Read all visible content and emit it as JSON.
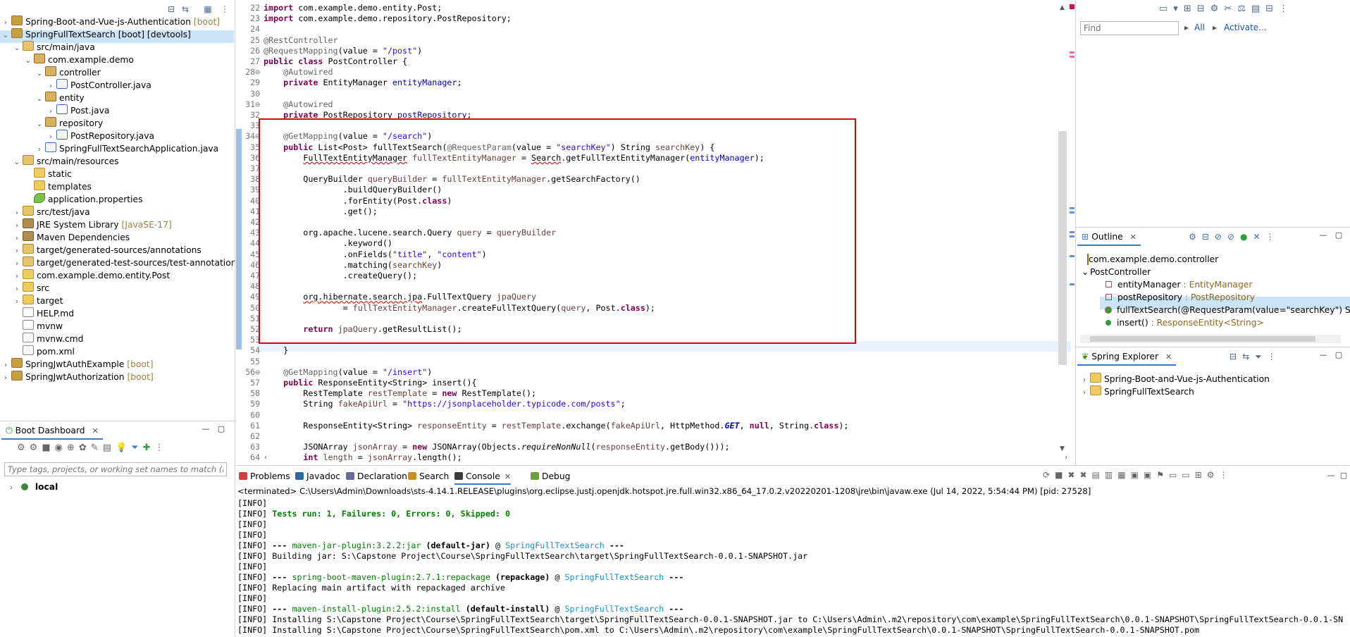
{
  "explorer": {
    "items": [
      {
        "arrow": "›",
        "icon": "proj",
        "label": "Spring-Boot-and-Vue-js-Authentication",
        "tag": "[boot]",
        "indent": 0
      },
      {
        "arrow": "⌄",
        "icon": "proj",
        "label": "SpringFullTextSearch [boot] [devtools]",
        "tag": "",
        "indent": 0
      },
      {
        "arrow": "⌄",
        "icon": "src",
        "label": "src/main/java",
        "tag": "",
        "indent": 1
      },
      {
        "arrow": "⌄",
        "icon": "pkg",
        "label": "com.example.demo",
        "tag": "",
        "indent": 2
      },
      {
        "arrow": "⌄",
        "icon": "pkg",
        "label": "controller",
        "tag": "",
        "indent": 3
      },
      {
        "arrow": "›",
        "icon": "java",
        "label": "PostController.java",
        "tag": "",
        "indent": 4
      },
      {
        "arrow": "⌄",
        "icon": "pkg",
        "label": "entity",
        "tag": "",
        "indent": 3
      },
      {
        "arrow": "›",
        "icon": "java",
        "label": "Post.java",
        "tag": "",
        "indent": 4
      },
      {
        "arrow": "⌄",
        "icon": "pkg",
        "label": "repository",
        "tag": "",
        "indent": 3
      },
      {
        "arrow": "›",
        "icon": "java",
        "label": "PostRepository.java",
        "tag": "",
        "indent": 4
      },
      {
        "arrow": "›",
        "icon": "java",
        "label": "SpringFullTextSearchApplication.java",
        "tag": "",
        "indent": 3
      },
      {
        "arrow": "⌄",
        "icon": "src",
        "label": "src/main/resources",
        "tag": "",
        "indent": 1
      },
      {
        "arrow": "",
        "icon": "folder",
        "label": "static",
        "tag": "",
        "indent": 2
      },
      {
        "arrow": "",
        "icon": "folder",
        "label": "templates",
        "tag": "",
        "indent": 2
      },
      {
        "arrow": "",
        "icon": "leaf",
        "label": "application.properties",
        "tag": "",
        "indent": 2
      },
      {
        "arrow": "›",
        "icon": "src",
        "label": "src/test/java",
        "tag": "",
        "indent": 1
      },
      {
        "arrow": "›",
        "icon": "lib",
        "label": "JRE System Library",
        "tag": "[JavaSE-17]",
        "indent": 1
      },
      {
        "arrow": "›",
        "icon": "lib",
        "label": "Maven Dependencies",
        "tag": "",
        "indent": 1
      },
      {
        "arrow": "›",
        "icon": "src",
        "label": "target/generated-sources/annotations",
        "tag": "",
        "indent": 1
      },
      {
        "arrow": "›",
        "icon": "src",
        "label": "target/generated-test-sources/test-annotations",
        "tag": "",
        "indent": 1
      },
      {
        "arrow": "›",
        "icon": "folder",
        "label": "com.example.demo.entity.Post",
        "tag": "",
        "indent": 1
      },
      {
        "arrow": "›",
        "icon": "folder",
        "label": "src",
        "tag": "",
        "indent": 1
      },
      {
        "arrow": "›",
        "icon": "folder",
        "label": "target",
        "tag": "",
        "indent": 1
      },
      {
        "arrow": "",
        "icon": "file",
        "label": "HELP.md",
        "tag": "",
        "indent": 1
      },
      {
        "arrow": "",
        "icon": "file",
        "label": "mvnw",
        "tag": "",
        "indent": 1
      },
      {
        "arrow": "",
        "icon": "file",
        "label": "mvnw.cmd",
        "tag": "",
        "indent": 1
      },
      {
        "arrow": "",
        "icon": "file",
        "label": "pom.xml",
        "tag": "",
        "indent": 1
      },
      {
        "arrow": "›",
        "icon": "proj",
        "label": "SpringJwtAuthExample",
        "tag": "[boot]",
        "indent": 0
      },
      {
        "arrow": "›",
        "icon": "proj",
        "label": "SpringJwtAuthorization",
        "tag": "[boot]",
        "indent": 0
      }
    ]
  },
  "boot_dashboard": {
    "tab_label": "Boot Dashboard",
    "filter_placeholder": "Type tags, projects, or working set names to match (incl. * a",
    "local_label": "local"
  },
  "editor": {
    "lines": [
      {
        "n": "22",
        "h": "<span class='kw'>import</span> com.example.demo.entity.Post;"
      },
      {
        "n": "23",
        "h": "<span class='kw'>import</span> com.example.demo.repository.PostRepository;"
      },
      {
        "n": "24",
        "h": ""
      },
      {
        "n": "25",
        "h": "<span class='ann'>@RestController</span>"
      },
      {
        "n": "26",
        "h": "<span class='ann'>@RequestMapping</span>(value = <span class='str'>\"/post\"</span>)"
      },
      {
        "n": "27",
        "h": "<span class='kw'>public class</span> PostController {"
      },
      {
        "n": "28⊖",
        "h": "    <span class='ann'>@Autowired</span>"
      },
      {
        "n": "29",
        "h": "    <span class='kw'>private</span> EntityManager <span class='fld'>entityManager</span>;"
      },
      {
        "n": "30",
        "h": ""
      },
      {
        "n": "31⊖",
        "h": "    <span class='ann'>@Autowired</span>"
      },
      {
        "n": "32",
        "h": "    <span class='kw'>private</span> PostRepository <span class='fld'>postRepository</span>;"
      },
      {
        "n": "33",
        "h": ""
      },
      {
        "n": "34⊖",
        "h": "    <span class='ann'>@GetMapping</span>(value = <span class='str'>\"/search\"</span>)"
      },
      {
        "n": "35",
        "h": "    <span class='kw'>public</span> List&lt;Post&gt; fullTextSearch(<span class='ann'>@RequestParam</span>(value = <span class='str'>\"searchKey\"</span>) String <span class='var'>searchKey</span>) {"
      },
      {
        "n": "36",
        "h": "        <span class='err'>FullTextEntityManager</span> <span class='var'>fullTextEntityManager</span> = <span class='err'>Search</span>.getFullTextEntityManager(<span class='fld'>entityManager</span>);"
      },
      {
        "n": "37",
        "h": ""
      },
      {
        "n": "38",
        "h": "        QueryBuilder <span class='var'>queryBuilder</span> = <span class='var'>fullTextEntityManager</span>.getSearchFactory()"
      },
      {
        "n": "39",
        "h": "                .buildQueryBuilder()"
      },
      {
        "n": "40",
        "h": "                .forEntity(Post.<span class='kw'>class</span>)"
      },
      {
        "n": "41",
        "h": "                .get();"
      },
      {
        "n": "42",
        "h": ""
      },
      {
        "n": "43",
        "h": "        org.apache.lucene.search.Query <span class='var'>query</span> = <span class='var'>queryBuilder</span>"
      },
      {
        "n": "44",
        "h": "                .keyword()"
      },
      {
        "n": "45",
        "h": "                .onFields(<span class='str'>\"title\"</span>, <span class='str'>\"content\"</span>)"
      },
      {
        "n": "46",
        "h": "                .matching(<span class='var'>searchKey</span>)"
      },
      {
        "n": "47",
        "h": "                .createQuery();"
      },
      {
        "n": "48",
        "h": ""
      },
      {
        "n": "49",
        "h": "        <span class='err'>org.hibernate.search.jpa</span>.FullTextQuery <span class='var'>jpaQuery</span>"
      },
      {
        "n": "50",
        "h": "                = <span class='var'>fullTextEntityManager</span>.createFullTextQuery(<span class='var'>query</span>, Post.<span class='kw'>class</span>);"
      },
      {
        "n": "51",
        "h": ""
      },
      {
        "n": "52",
        "h": "        <span class='kw'>return</span> <span class='var'>jpaQuery</span>.getResultList();"
      },
      {
        "n": "53",
        "h": ""
      },
      {
        "n": "54",
        "h": "    }"
      },
      {
        "n": "55",
        "h": ""
      },
      {
        "n": "56⊖",
        "h": "    <span class='ann'>@GetMapping</span>(value = <span class='str'>\"/insert\"</span>)"
      },
      {
        "n": "57",
        "h": "    <span class='kw'>public</span> ResponseEntity&lt;String&gt; insert(){"
      },
      {
        "n": "58",
        "h": "        RestTemplate <span class='var'>restTemplate</span> = <span class='kw'>new</span> RestTemplate();"
      },
      {
        "n": "59",
        "h": "        String <span class='var'>fakeApiUrl</span> = <span class='str'>\"https://jsonplaceholder.typicode.com/posts\"</span>;"
      },
      {
        "n": "60",
        "h": ""
      },
      {
        "n": "61",
        "h": "        ResponseEntity&lt;String&gt; <span class='var'>responseEntity</span> = <span class='var'>restTemplate</span>.exchange(<span class='var'>fakeApiUrl</span>, HttpMethod.<span class='sta'>GET</span>, <span class='kw'>null</span>, String.<span class='kw'>class</span>);"
      },
      {
        "n": "62",
        "h": ""
      },
      {
        "n": "63",
        "h": "        JSONArray <span class='var'>jsonArray</span> = <span class='kw'>new</span> JSONArray(Objects.<i>requireNonNull</i>(<span class='var'>responseEntity</span>.getBody()));"
      },
      {
        "n": "64",
        "h": "        <span class='kw'>int</span> <span class='var'>length</span> = <span class='var'>jsonArray</span>.length();"
      }
    ]
  },
  "quick": {
    "find_placeholder": "Find",
    "all_label": "All",
    "activate_label": "Activate..."
  },
  "outline": {
    "tab_label": "Outline",
    "items": [
      {
        "kind": "pkg",
        "label": "com.example.demo.controller",
        "type": ""
      },
      {
        "kind": "class",
        "label": "PostController",
        "type": ""
      },
      {
        "kind": "field",
        "label": "entityManager",
        "type": " : EntityManager"
      },
      {
        "kind": "field",
        "label": "postRepository",
        "type": " : PostRepository"
      },
      {
        "kind": "method-err",
        "label": "fullTextSearch(@RequestParam(value=\"searchKey\") String) : L",
        "type": ""
      },
      {
        "kind": "method",
        "label": "insert()",
        "type": " : ResponseEntity<String>"
      }
    ]
  },
  "spring_explorer": {
    "tab_label": "Spring Explorer",
    "items": [
      "Spring-Boot-and-Vue-js-Authentication",
      "SpringFullTextSearch"
    ]
  },
  "console": {
    "tabs": [
      "Problems",
      "Javadoc",
      "Declaration",
      "Search",
      "Console",
      "Debug"
    ],
    "active_tab": "Console",
    "terminated": "<terminated> C:\\Users\\Admin\\Downloads\\sts-4.14.1.RELEASE\\plugins\\org.eclipse.justj.openjdk.hotspot.jre.full.win32.x86_64_17.0.2.v20220201-1208\\jre\\bin\\javaw.exe  (Jul 14, 2022, 5:54:44 PM) [pid: 27528]",
    "lines": [
      "[INFO]",
      "[INFO] <span class='grn'>Tests run: 1, Failures: 0, Errors: 0, Skipped: 0</span>",
      "[INFO]",
      "[INFO]",
      "[INFO] <span class='bld'>---</span> <span class='plg'>maven-jar-plugin:3.2.2:jar</span> <span class='bld'>(default-jar)</span> @ <span class='blu'>SpringFullTextSearch</span> <span class='bld'>---</span>",
      "[INFO] Building jar: S:\\Capstone Project\\Course\\SpringFullTextSearch\\target\\SpringFullTextSearch-0.0.1-SNAPSHOT.jar",
      "[INFO]",
      "[INFO] <span class='bld'>---</span> <span class='plg'>spring-boot-maven-plugin:2.7.1:repackage</span> <span class='bld'>(repackage)</span> @ <span class='blu'>SpringFullTextSearch</span> <span class='bld'>---</span>",
      "[INFO] Replacing main artifact with repackaged archive",
      "[INFO]",
      "[INFO] <span class='bld'>---</span> <span class='plg'>maven-install-plugin:2.5.2:install</span> <span class='bld'>(default-install)</span> @ <span class='blu'>SpringFullTextSearch</span> <span class='bld'>---</span>",
      "[INFO] Installing S:\\Capstone Project\\Course\\SpringFullTextSearch\\target\\SpringFullTextSearch-0.0.1-SNAPSHOT.jar to C:\\Users\\Admin\\.m2\\repository\\com\\example\\SpringFullTextSearch\\0.0.1-SNAPSHOT\\SpringFullTextSearch-0.0.1-SN",
      "[INFO] Installing S:\\Capstone Project\\Course\\SpringFullTextSearch\\pom.xml to C:\\Users\\Admin\\.m2\\repository\\com\\example\\SpringFullTextSearch\\0.0.1-SNAPSHOT\\SpringFullTextSearch-0.0.1-SNAPSHOT.pom"
    ]
  }
}
